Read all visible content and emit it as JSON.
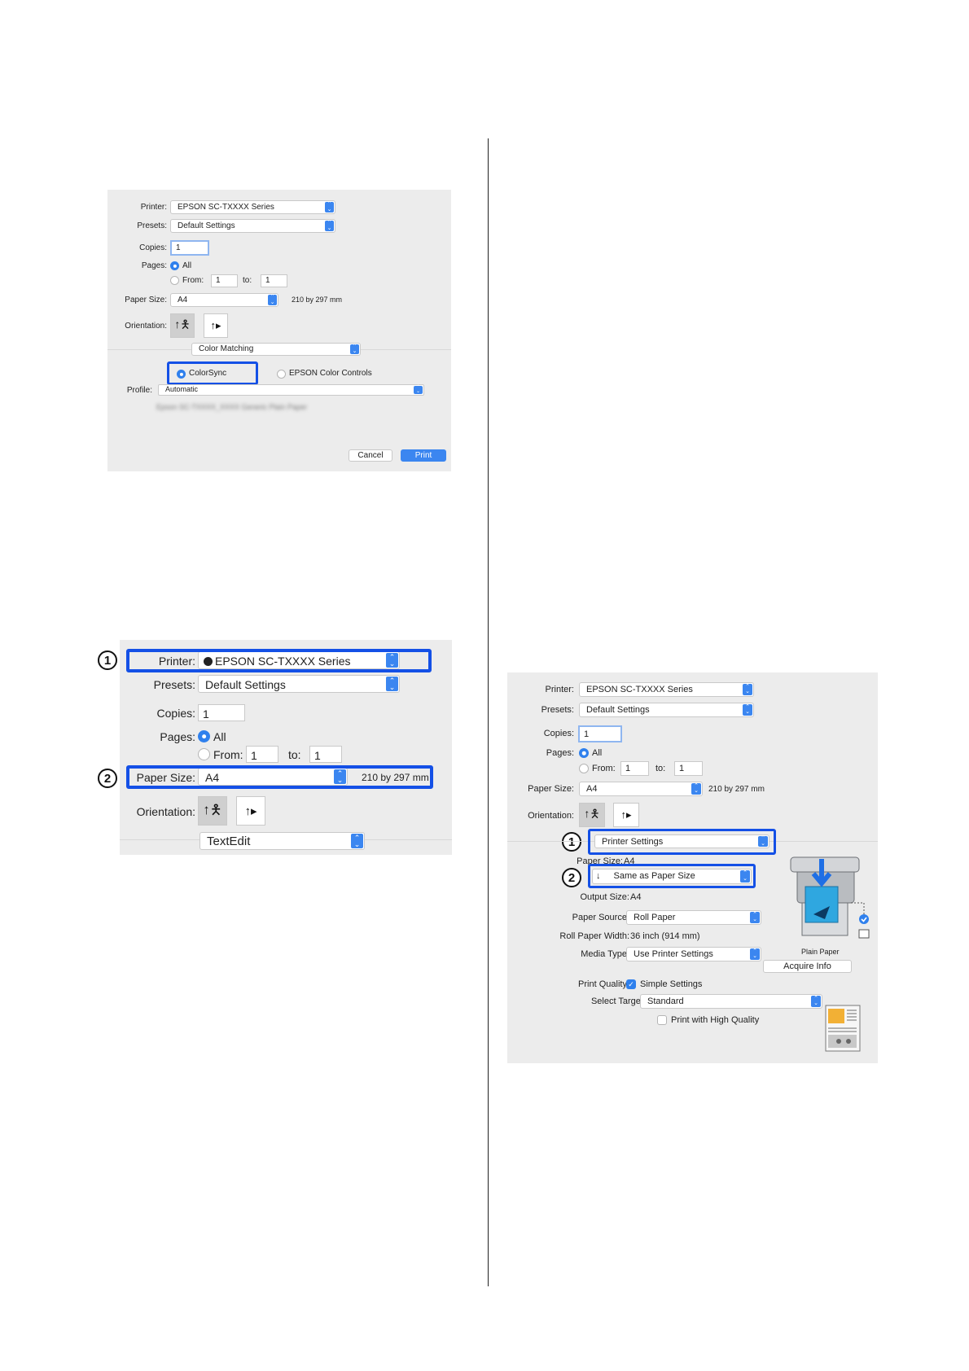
{
  "panel1": {
    "printer_label": "Printer:",
    "printer_value": "EPSON SC-TXXXX Series",
    "presets_label": "Presets:",
    "presets_value": "Default Settings",
    "copies_label": "Copies:",
    "copies_value": "1",
    "pages_label": "Pages:",
    "pages_all": "All",
    "pages_from": "From:",
    "from_value": "1",
    "to_label": "to:",
    "to_value": "1",
    "paper_size_label": "Paper Size:",
    "paper_size_value": "A4",
    "paper_dims": "210 by 297 mm",
    "orientation_label": "Orientation:",
    "section_value": "Color Matching",
    "colorsync": "ColorSync",
    "epson_color_controls": "EPSON Color Controls",
    "profile_label": "Profile:",
    "profile_value": "Automatic",
    "profile_detail": "Epson SC-TXXXX_XXXX Generic Plain Paper",
    "cancel": "Cancel",
    "print": "Print"
  },
  "panel2": {
    "callout1": "1",
    "callout2": "2",
    "printer_label": "Printer:",
    "printer_value": "EPSON SC-TXXXX Series",
    "presets_label": "Presets:",
    "presets_value": "Default Settings",
    "copies_label": "Copies:",
    "copies_value": "1",
    "pages_label": "Pages:",
    "pages_all": "All",
    "pages_from": "From:",
    "from_value": "1",
    "to_label": "to:",
    "to_value": "1",
    "paper_size_label": "Paper Size:",
    "paper_size_value": "A4",
    "paper_dims": "210 by 297 mm",
    "orientation_label": "Orientation:",
    "section_value": "TextEdit"
  },
  "panel3": {
    "callout1": "1",
    "callout2": "2",
    "printer_label": "Printer:",
    "printer_value": "EPSON SC-TXXXX Series",
    "presets_label": "Presets:",
    "presets_value": "Default Settings",
    "copies_label": "Copies:",
    "copies_value": "1",
    "pages_label": "Pages:",
    "pages_all": "All",
    "pages_from": "From:",
    "from_value": "1",
    "to_label": "to:",
    "to_value": "1",
    "paper_size_label": "Paper Size:",
    "paper_size_value": "A4",
    "paper_dims": "210 by 297 mm",
    "orientation_label": "Orientation:",
    "section_value": "Printer Settings",
    "paper_size_row_label": "Paper Size:",
    "paper_size_row_value": "A4",
    "reduce_value": "Same as Paper Size",
    "output_size_label": "Output Size:",
    "output_size_value": "A4",
    "paper_source_label": "Paper Source:",
    "paper_source_value": "Roll Paper",
    "roll_width_label": "Roll Paper Width:",
    "roll_width_value": "36 inch (914 mm)",
    "media_type_label": "Media Type:",
    "media_type_value": "Use Printer Settings",
    "plain_paper": "Plain Paper",
    "acquire_info": "Acquire Info",
    "print_quality_label": "Print Quality:",
    "simple_settings": "Simple Settings",
    "select_target_label": "Select Target:",
    "select_target_value": "Standard",
    "high_quality": "Print with High Quality"
  },
  "colors": {
    "accent": "#3b86f0",
    "highlight": "#1450e6",
    "panel_bg": "#ececec"
  }
}
